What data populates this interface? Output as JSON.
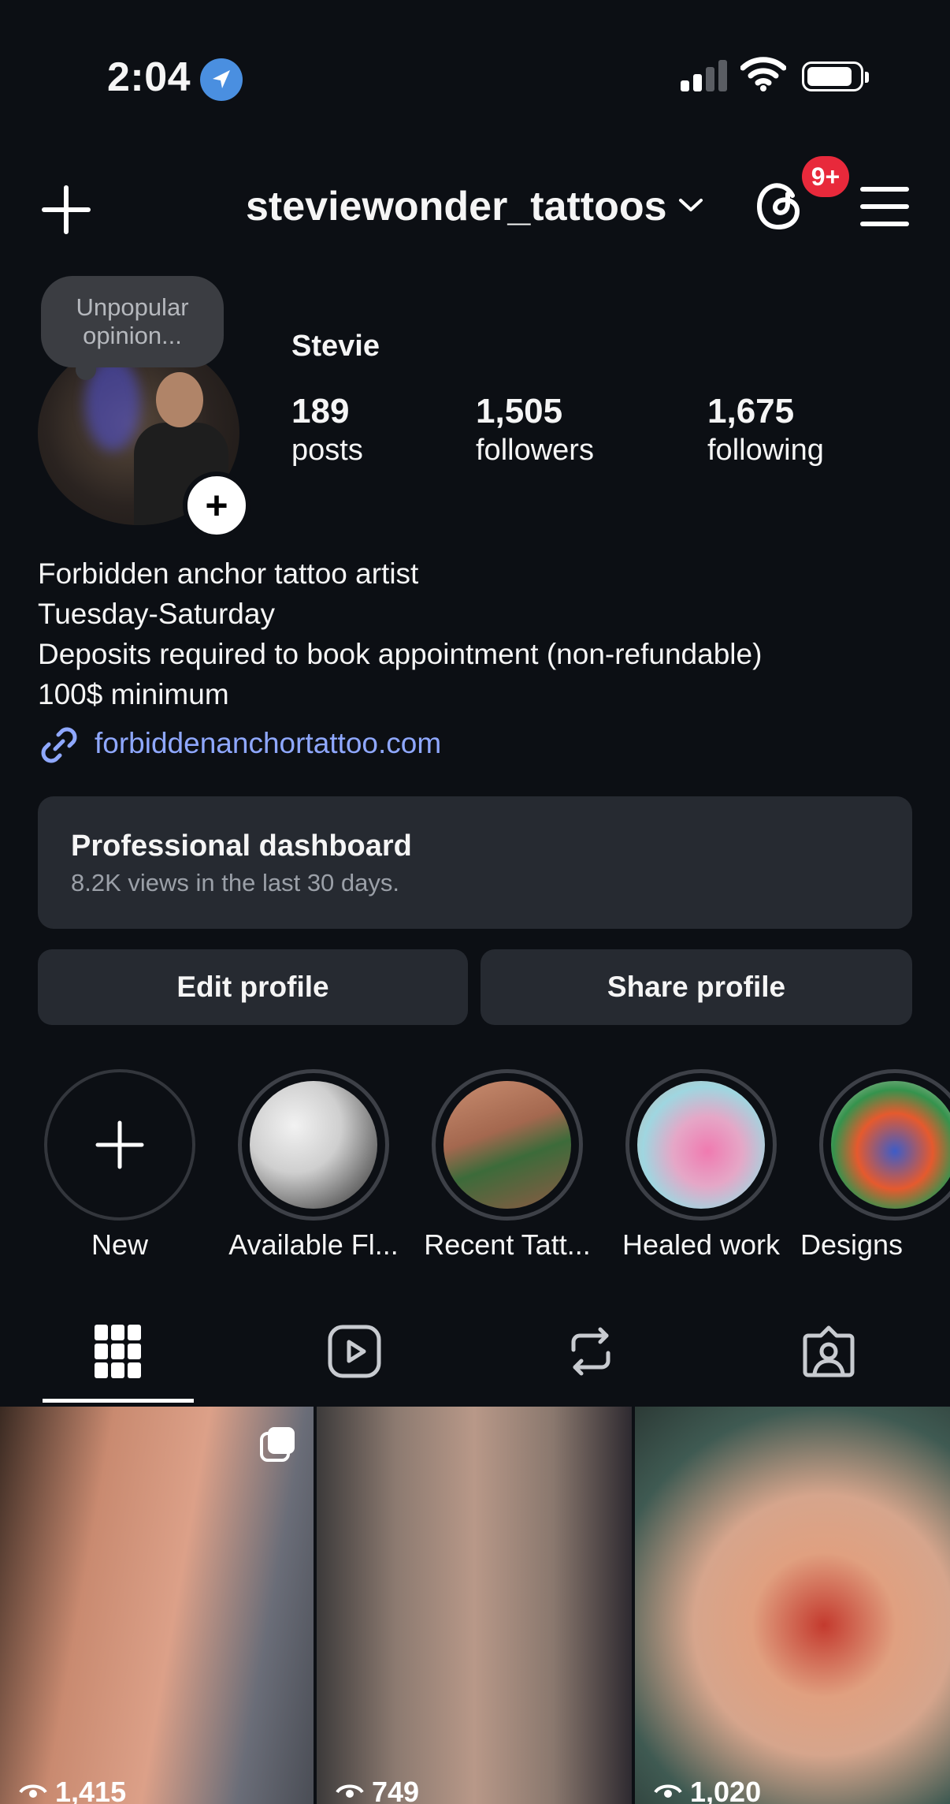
{
  "status_bar": {
    "time": "2:04",
    "location_icon": "location-arrow-icon",
    "signal_icon": "cellular-signal-icon",
    "wifi_icon": "wifi-icon",
    "battery_icon": "battery-icon"
  },
  "header": {
    "username": "steviewonder_tattoos",
    "notification_badge": "9+",
    "badge_color": "#e8293b"
  },
  "profile": {
    "note": [
      "Unpopular",
      "opinion..."
    ],
    "display_name": "Stevie",
    "stats": [
      {
        "value": "189",
        "label": "posts"
      },
      {
        "value": "1,505",
        "label": "followers"
      },
      {
        "value": "1,675",
        "label": "following"
      }
    ],
    "bio_lines": [
      "Forbidden anchor tattoo artist",
      "Tuesday-Saturday",
      "Deposits required to book appointment (non-refundable)",
      "100$ minimum"
    ],
    "link": "forbiddenanchortattoo.com",
    "link_color": "#8fa8ff"
  },
  "dashboard": {
    "title": "Professional dashboard",
    "subtitle": "8.2K views in the last 30 days."
  },
  "buttons": {
    "edit": "Edit profile",
    "share": "Share profile"
  },
  "highlights": [
    {
      "label": "New"
    },
    {
      "label": "Available Fl..."
    },
    {
      "label": "Recent Tatt..."
    },
    {
      "label": "Healed work"
    },
    {
      "label": "Designs"
    }
  ],
  "tabs": [
    "grid-icon",
    "reels-icon",
    "reposts-icon",
    "tagged-icon"
  ],
  "posts": [
    {
      "views": "1,415"
    },
    {
      "views": "749"
    },
    {
      "views": "1,020"
    }
  ],
  "colors": {
    "background": "#0c0f14",
    "card": "#262a31"
  }
}
